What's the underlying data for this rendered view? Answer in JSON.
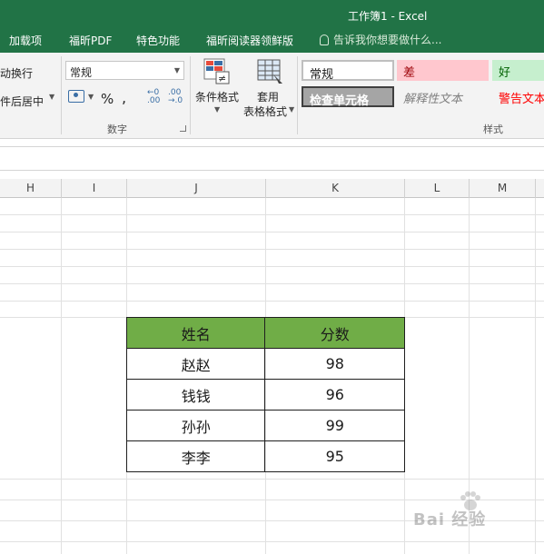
{
  "window": {
    "title": "工作簿1 - Excel"
  },
  "ribbon_tabs": [
    "加载项",
    "福昕PDF",
    "特色功能",
    "福昕阅读器领鲜版"
  ],
  "tell_me": {
    "placeholder": "告诉我你想要做什么..."
  },
  "ribbon": {
    "alignment": {
      "wrap_text": "动换行",
      "merge_center": "件后居中"
    },
    "number": {
      "format_value": "常规",
      "percent": "%",
      "comma": ",",
      "increase_decimal": "←0\n.00",
      "decrease_decimal": ".00\n→.0",
      "group_label": "数字"
    },
    "conditional_formatting": {
      "label": "条件格式"
    },
    "format_as_table": {
      "label_line1": "套用",
      "label_line2": "表格格式"
    },
    "styles": {
      "normal": "常规",
      "bad": "差",
      "good": "好",
      "check_cell": "检查单元格",
      "explanatory": "解释性文本",
      "warning": "警告文本",
      "group_label": "样式"
    }
  },
  "columns": [
    "H",
    "I",
    "J",
    "K",
    "L",
    "M"
  ],
  "table": {
    "headers": [
      "姓名",
      "分数"
    ],
    "rows": [
      [
        "赵赵",
        "98"
      ],
      [
        "钱钱",
        "96"
      ],
      [
        "孙孙",
        "99"
      ],
      [
        "李李",
        "95"
      ]
    ],
    "header_color": "#70ad47"
  },
  "watermark": "Bai 经验",
  "colors": {
    "brand": "#217346"
  }
}
